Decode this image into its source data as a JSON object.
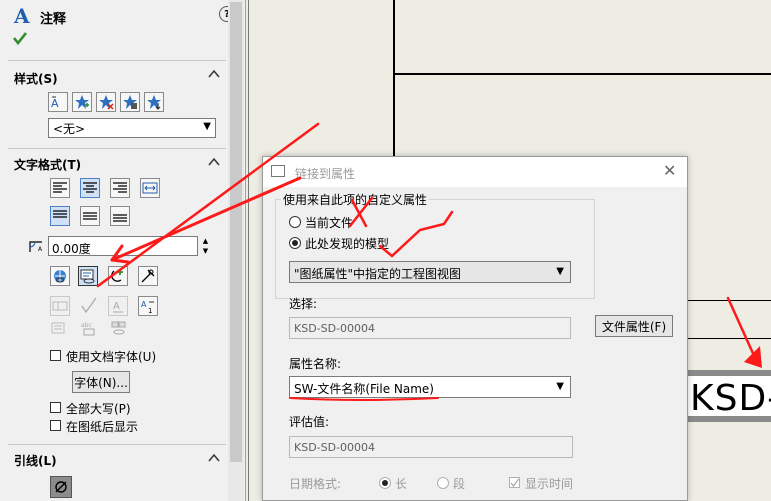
{
  "panel": {
    "title": "注释",
    "help": "?",
    "style_section": {
      "title": "样式(S)",
      "select_value": "<无>"
    },
    "text_format_section": {
      "title": "文字格式(T)",
      "angle_value": "0.00度",
      "use_doc_font_label": "使用文档字体(U)",
      "font_button_label": "字体(N)...",
      "all_caps_label": "全部大写(P)",
      "behind_sheet_label": "在图纸后显示"
    },
    "leader_section": {
      "title": "引线(L)"
    }
  },
  "drawing": {
    "text": "KSD-"
  },
  "dialog": {
    "title": "链接到属性",
    "group_label": "使用来自此项的自定义属性",
    "radio_current": "当前文件",
    "radio_model": "此处发现的模型",
    "model_select_value": "\"图纸属性\"中指定的工程图视图",
    "select_label": "选择:",
    "select_value": "KSD-SD-00004",
    "file_props_button": "文件属性(F)",
    "prop_name_label": "属性名称:",
    "prop_name_value": "SW-文件名称(File Name)",
    "eval_label": "评估值:",
    "eval_value": "KSD-SD-00004",
    "date_format_label": "日期格式:",
    "date_long": "长",
    "date_short": "段",
    "show_time_label": "显示时间"
  },
  "colors": {
    "accent": "#1f5fae",
    "check": "#2e8b2e",
    "annotation": "#ff1a1a"
  }
}
